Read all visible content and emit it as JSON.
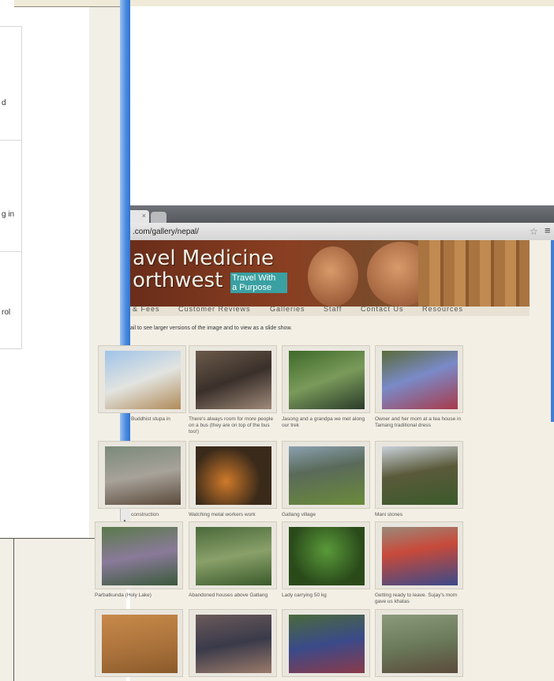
{
  "left_window": {
    "list_fragments": [
      "d",
      "g in",
      "rol"
    ]
  },
  "browser": {
    "tab_label": "×",
    "url": ".com/gallery/nepal/",
    "star_icon": "star-icon",
    "menu_icon": "menu-icon"
  },
  "banner": {
    "title_line1": "avel Medicine",
    "title_line2": "orthwest",
    "tagline_line1": "Travel With",
    "tagline_line2": "a Purpose"
  },
  "nav": {
    "items": [
      "& Fees",
      "Customer Reviews",
      "Galleries",
      "Staff",
      "Contact Us",
      "Resources"
    ]
  },
  "gallery": {
    "instruction": "ail to see larger versions of the image and to view as a slide show.",
    "captions": [
      "Buddhist stupa in",
      "There's always room for more people on a bus (they are on top of the bus too!)",
      "Jasong and a grandpa we met along our trek",
      "Owner and her mom at a tea house in Tamang traditional dress",
      "construction",
      "Watching metal workers work",
      "Gatlang village",
      "Mani stones",
      "Parbatkunda (Holy Lake)",
      "Abandoned houses above Gatlang",
      "Lady carrying 50 kg",
      "Getting ready to leave. Sujay's mom gave us khatas"
    ]
  }
}
